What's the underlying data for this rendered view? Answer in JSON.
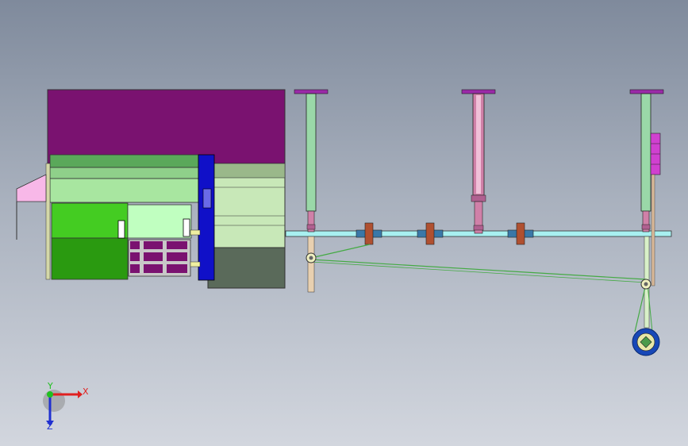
{
  "viewport": {
    "background_top": "#7f8a9c",
    "background_bottom": "#d2d6de"
  },
  "model": {
    "colors": {
      "housing_top": "#7a1270",
      "green_panel": "#5aa85a",
      "light_green": "#a8e6a0",
      "bright_green": "#44cc22",
      "dark_green": "#2a9a10",
      "blue_plate": "#1010c8",
      "pale_green_block": "#c8e8b8",
      "dark_block": "#5a6a5a",
      "shaft_cyan": "#a8f0f0",
      "cylinder_green": "#9ad8a8",
      "cylinder_pink": "#d080a8",
      "cap_purple": "#9a2aa8",
      "nut_brown": "#b05030",
      "magenta_block": "#d040d0",
      "wheel_blue": "#1848b8",
      "wheel_inner": "#e8e8a8"
    }
  },
  "triad": {
    "x_label": "X",
    "y_label": "Y",
    "z_label": "Z",
    "x_color": "#e02020",
    "y_color": "#20c020",
    "z_color": "#2030d0"
  }
}
